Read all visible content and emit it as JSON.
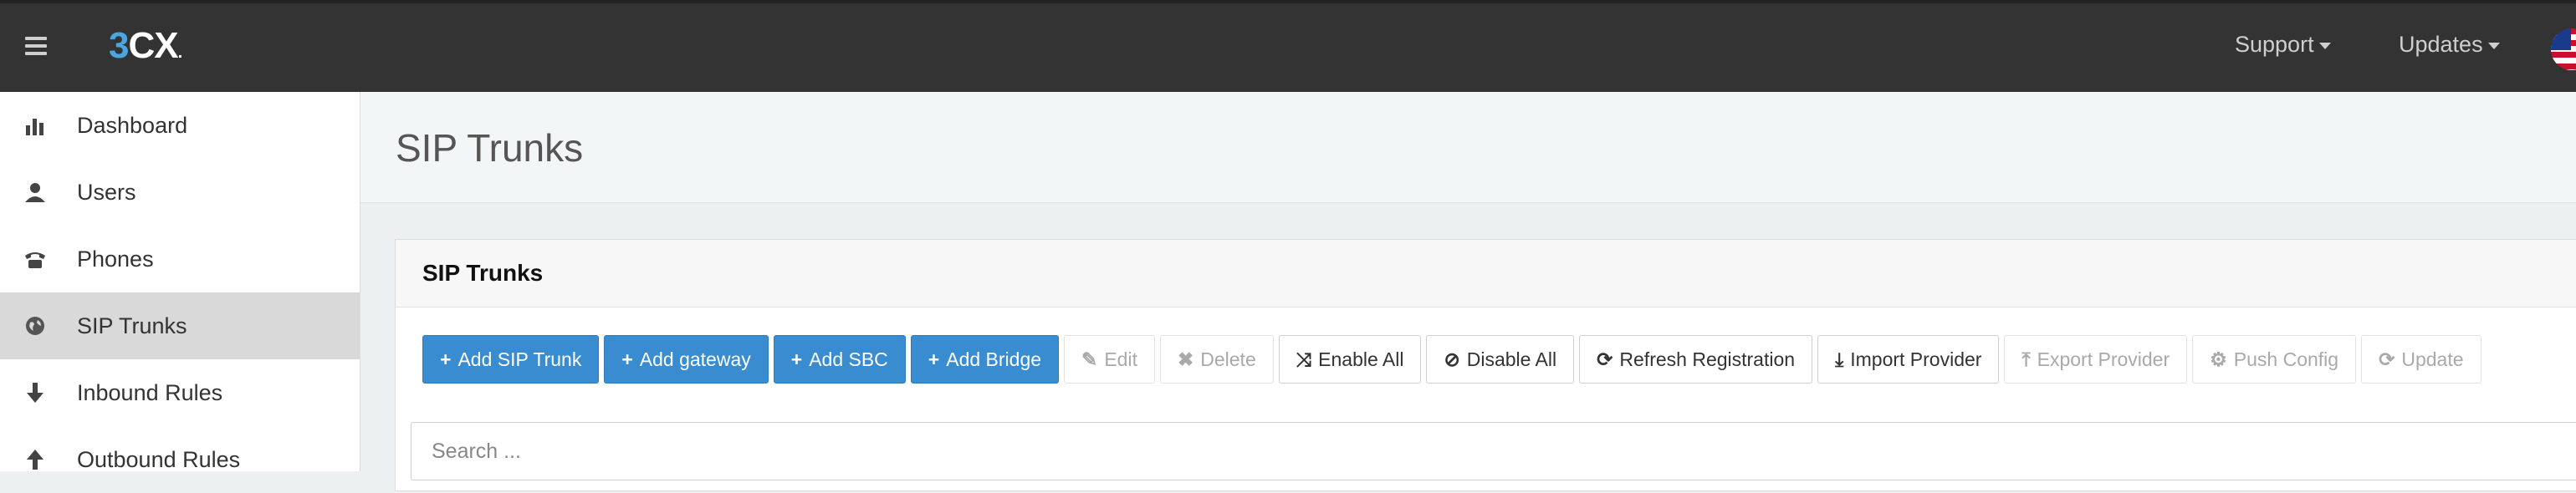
{
  "header": {
    "logo": {
      "three": "3",
      "cx": "CX",
      "dot": "."
    },
    "nav": [
      {
        "label": "Support"
      },
      {
        "label": "Updates"
      }
    ]
  },
  "sidebar": {
    "items": [
      {
        "label": "Dashboard",
        "icon": "bar-chart-icon"
      },
      {
        "label": "Users",
        "icon": "user-icon"
      },
      {
        "label": "Phones",
        "icon": "phone-icon"
      },
      {
        "label": "SIP Trunks",
        "icon": "globe-icon",
        "active": true
      },
      {
        "label": "Inbound Rules",
        "icon": "arrow-down-icon"
      },
      {
        "label": "Outbound Rules",
        "icon": "arrow-up-icon"
      }
    ]
  },
  "page": {
    "title": "SIP Trunks"
  },
  "panel": {
    "title": "SIP Trunks",
    "buttons": [
      {
        "label": "Add SIP Trunk",
        "icon": "+",
        "style": "primary"
      },
      {
        "label": "Add gateway",
        "icon": "+",
        "style": "primary"
      },
      {
        "label": "Add SBC",
        "icon": "+",
        "style": "primary"
      },
      {
        "label": "Add Bridge",
        "icon": "+",
        "style": "primary"
      },
      {
        "label": "Edit",
        "icon": "✎",
        "style": "disabled"
      },
      {
        "label": "Delete",
        "icon": "✖",
        "style": "disabled"
      },
      {
        "label": "Enable All",
        "icon": "⤨",
        "style": "default"
      },
      {
        "label": "Disable All",
        "icon": "⊘",
        "style": "default"
      },
      {
        "label": "Refresh Registration",
        "icon": "⟳",
        "style": "default"
      },
      {
        "label": "Import Provider",
        "icon": "⤓",
        "style": "default"
      },
      {
        "label": "Export Provider",
        "icon": "⤒",
        "style": "disabled"
      },
      {
        "label": "Push Config",
        "icon": "⚙",
        "style": "disabled"
      },
      {
        "label": "Update",
        "icon": "⟳",
        "style": "disabled"
      }
    ],
    "search": {
      "placeholder": "Search ..."
    }
  },
  "colors": {
    "primary": "#3a8cd0",
    "topbar": "#333333",
    "active_sidebar": "#d9d9d9"
  }
}
